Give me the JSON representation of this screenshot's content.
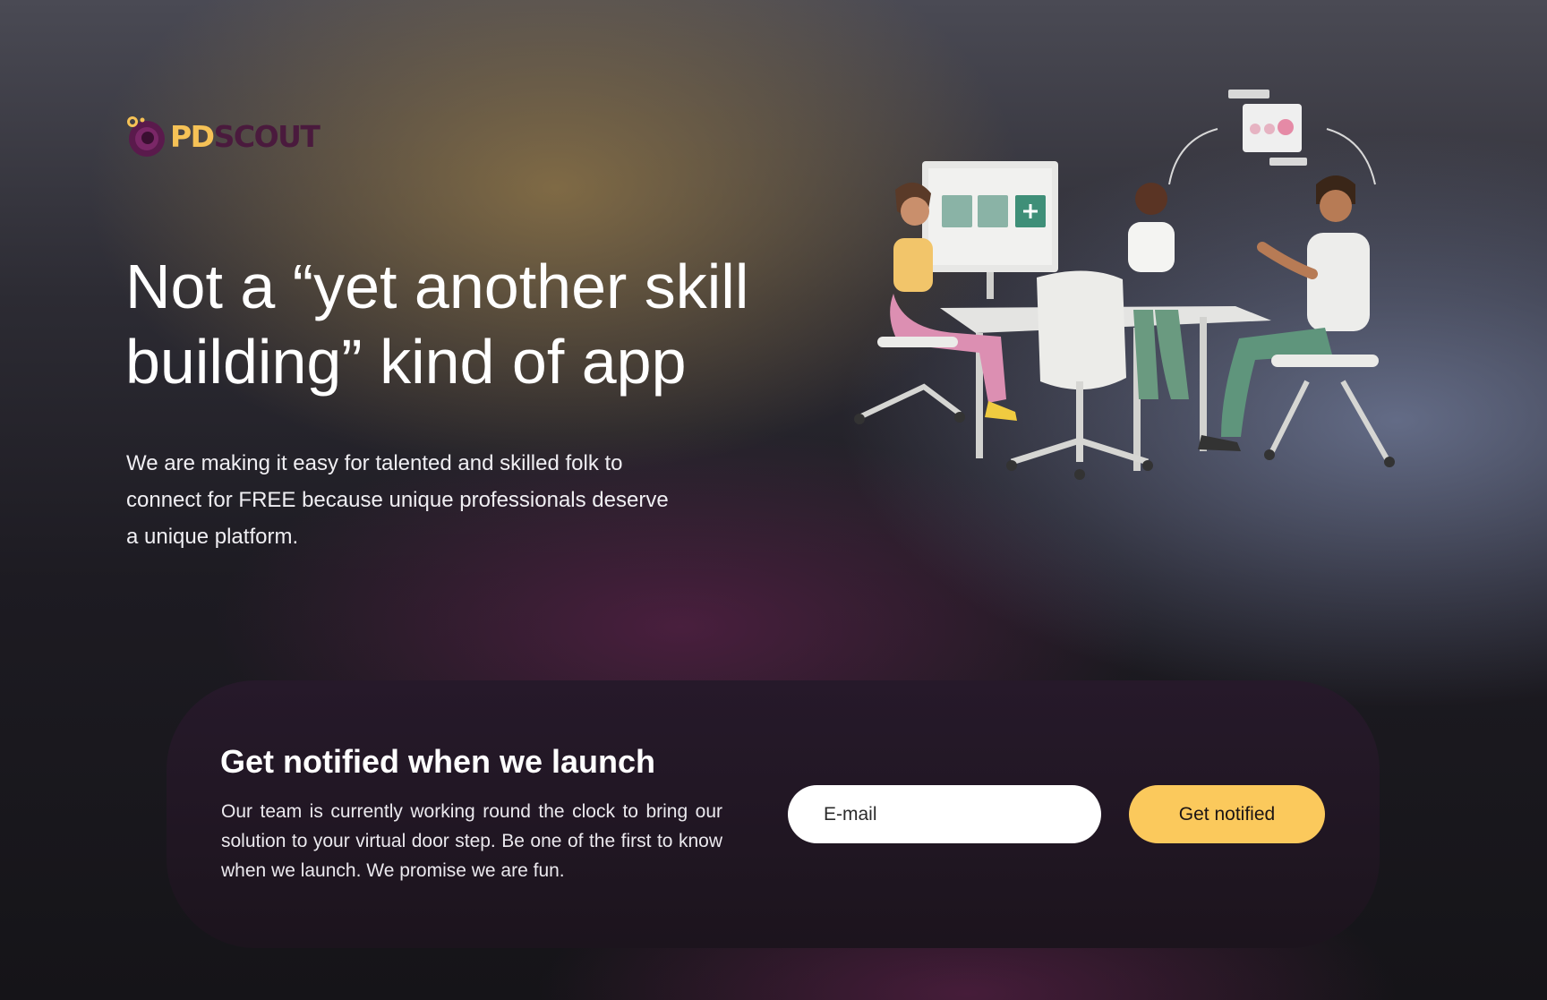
{
  "brand": {
    "logo_part1": "PD",
    "logo_part2": "SCOUT",
    "accent_color": "#f6c256",
    "brand_color": "#4a1a3d"
  },
  "hero": {
    "title": "Not a “yet another skill building” kind of app",
    "description": "We are making it easy for talented and skilled folk to connect for FREE because unique professionals deserve a unique platform."
  },
  "notify": {
    "title": "Get notified when we launch",
    "description": "Our team is currently working round the clock to bring our solution to your virtual door step. Be one of the first to know when we launch. We promise we are fun.",
    "email_placeholder": "E-mail",
    "button_label": "Get notified",
    "button_color": "#fbc95c"
  }
}
